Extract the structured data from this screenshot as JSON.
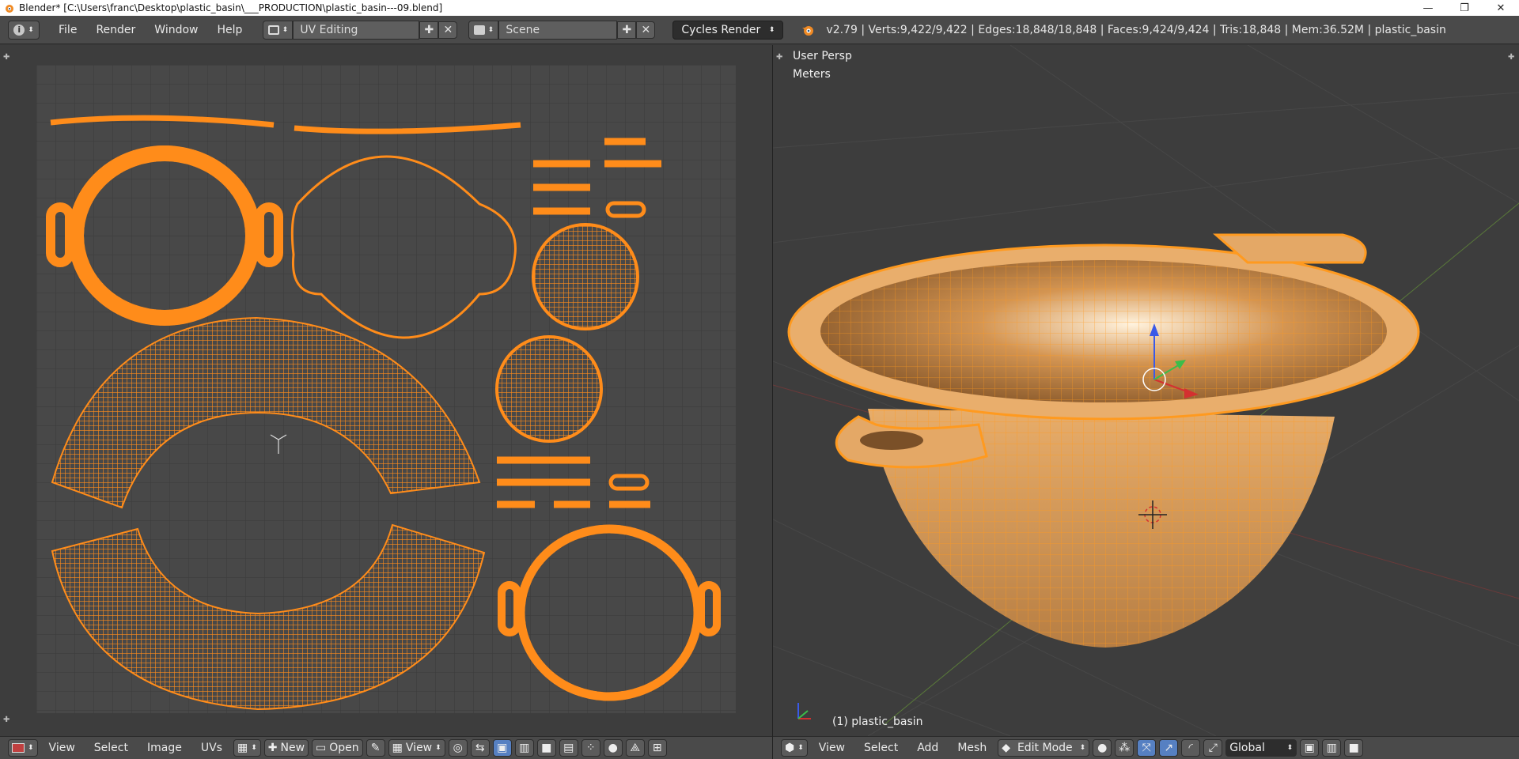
{
  "window": {
    "title": "Blender* [C:\\Users\\franc\\Desktop\\plastic_basin\\___PRODUCTION\\plastic_basin---09.blend]",
    "minimize": "—",
    "maximize": "❐",
    "close": "✕"
  },
  "info_header": {
    "menus": [
      "File",
      "Render",
      "Window",
      "Help"
    ],
    "screen_layout": "UV Editing",
    "scene": "Scene",
    "render_engine": "Cycles Render",
    "stats": "v2.79 | Verts:9,422/9,422 | Edges:18,848/18,848 | Faces:9,424/9,424 | Tris:18,848 | Mem:36.52M | plastic_basin"
  },
  "viewport": {
    "view_name": "User Persp",
    "units": "Meters",
    "object_label": "(1) plastic_basin"
  },
  "uv_header": {
    "menus": [
      "View",
      "Select",
      "Image",
      "UVs"
    ],
    "new_label": "New",
    "open_label": "Open",
    "view_label": "View"
  },
  "view3d_header": {
    "menus": [
      "View",
      "Select",
      "Add",
      "Mesh"
    ],
    "mode": "Edit Mode",
    "orientation": "Global"
  },
  "colors": {
    "selection": "#ff8c1a",
    "grid_bg": "#454545",
    "panel": "#4a4a4a"
  }
}
